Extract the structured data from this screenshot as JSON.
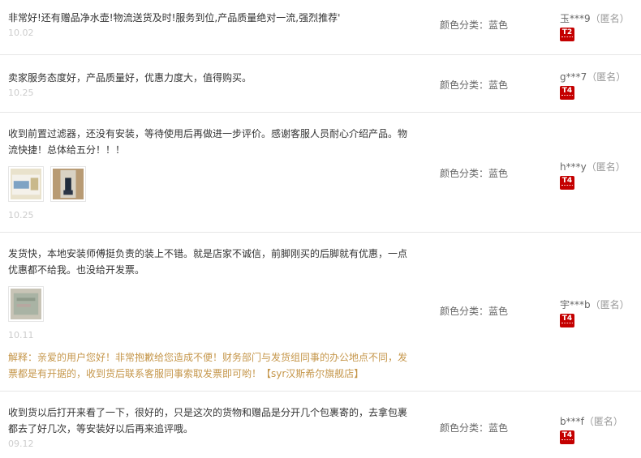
{
  "reviews": [
    {
      "text": "非常好!还有赠品净水壶!物流送货及时!服务到位,产品质量绝对一流,强烈推荐'",
      "date": "10.02",
      "sku": "颜色分类：蓝色",
      "user": "玉***9",
      "anon": "（匿名）",
      "level": "T2"
    },
    {
      "text": "卖家服务态度好，产品质量好，优惠力度大，值得购买。",
      "date": "10.25",
      "sku": "颜色分类：蓝色",
      "user": "g***7",
      "anon": "（匿名）",
      "level": "T4"
    },
    {
      "text": "收到前置过滤器，还没有安装，等待使用后再做进一步评价。感谢客服人员耐心介绍产品。物流快捷！总体给五分！！！",
      "date": "10.25",
      "sku": "颜色分类：蓝色",
      "user": "h***y",
      "anon": "（匿名）",
      "level": "T4"
    },
    {
      "text": "发货快，本地安装师傅挺负责的装上不错。就是店家不诚信，前脚刚买的后脚就有优惠，一点优惠都不给我。也没给开发票。",
      "date": "10.11",
      "reply": "解释：亲爱的用户您好！非常抱歉给您造成不便！财务部门与发货组同事的办公地点不同，发票都是有开据的，收到货后联系客服同事索取发票即可哟！【syr汉斯希尔旗舰店】",
      "sku": "颜色分类：蓝色",
      "user": "宇***b",
      "anon": "（匿名）",
      "level": "T4"
    },
    {
      "text": "收到货以后打开来看了一下，很好的，只是这次的货物和赠品是分开几个包裹寄的，去拿包裹都去了好几次，等安装好以后再来追评哦。",
      "date": "09.12",
      "sku": "颜色分类：蓝色",
      "user": "b***f",
      "anon": "（匿名）",
      "level": "T4"
    }
  ],
  "colors": {
    "reply": "#c5964a",
    "date": "#cccccc",
    "badge": "#c40000"
  }
}
